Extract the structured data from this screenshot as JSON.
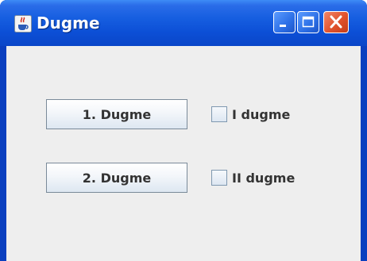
{
  "window": {
    "title": "Dugme",
    "app_icon": "java-coffee-icon"
  },
  "titlebar_buttons": [
    "minimize-icon",
    "maximize-icon",
    "close-icon"
  ],
  "buttons": [
    {
      "label": "1. Dugme"
    },
    {
      "label": "2. Dugme"
    }
  ],
  "checkboxes": [
    {
      "label": "I dugme",
      "checked": false
    },
    {
      "label": "II dugme",
      "checked": false
    }
  ],
  "colors": {
    "titlebar": "#0c4fd6",
    "close": "#e0522c",
    "client": "#eeeeee"
  }
}
